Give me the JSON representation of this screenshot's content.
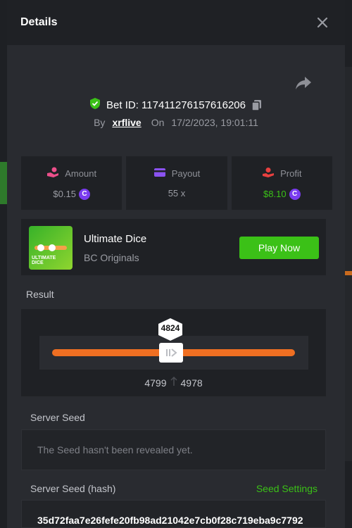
{
  "modal": {
    "title": "Details",
    "close_icon": "close-icon",
    "share_icon": "share-icon"
  },
  "bet": {
    "id_label": "Bet ID: 117411276157616206",
    "by_label": "By",
    "user": "xrflive",
    "on_label": "On",
    "datetime": "17/2/2023, 19:01:11"
  },
  "stats": {
    "amount": {
      "label": "Amount",
      "value": "$0.15",
      "icon": "hand-coins-icon"
    },
    "payout": {
      "label": "Payout",
      "value": "55 x",
      "icon": "card-icon"
    },
    "profit": {
      "label": "Profit",
      "value": "$8.10",
      "icon": "profit-icon"
    }
  },
  "game": {
    "thumb_text": "ULTIMATE DICE",
    "name": "Ultimate Dice",
    "provider": "BC Originals",
    "play_label": "Play Now"
  },
  "result": {
    "label": "Result",
    "value": "4824",
    "range_low": "4799",
    "range_high": "4978"
  },
  "server_seed": {
    "label": "Server Seed",
    "placeholder_text": "The Seed hasn't been revealed yet."
  },
  "server_seed_hash": {
    "label": "Server Seed (hash)",
    "settings_label": "Seed Settings",
    "hash": "35d72faa7e26fefe20fb98ad21042e7cb0f28c719eba9c7792"
  },
  "colors": {
    "accent_green": "#3bc117",
    "slider_orange": "#ef6f22",
    "coin_purple": "#7a3cf0",
    "amount_pink": "#ec4f8a",
    "payout_purple": "#8a52f0",
    "profit_red": "#e8403f"
  }
}
